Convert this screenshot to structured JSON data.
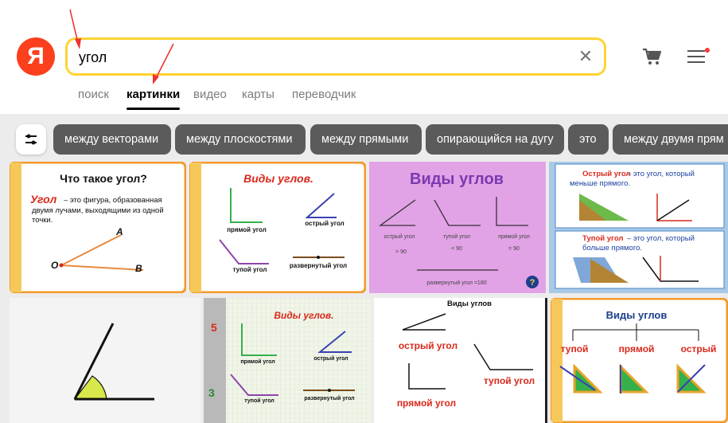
{
  "logo": {
    "letter": "Я"
  },
  "search": {
    "query": "угол",
    "clear_icon": "close-icon"
  },
  "tabs": [
    {
      "label": "поиск"
    },
    {
      "label": "картинки"
    },
    {
      "label": "видео"
    },
    {
      "label": "карты"
    },
    {
      "label": "переводчик"
    }
  ],
  "filters": {
    "settings_icon": "sliders-icon",
    "chips": [
      "между векторами",
      "между плоскостями",
      "между прямыми",
      "опирающийся на дугу",
      "это",
      "между двумя прям"
    ]
  },
  "images": {
    "img1": {
      "title": "Что такое угол?",
      "term": "Угол",
      "def1": " – это фигура, образованная",
      "def2": "двумя лучами, выходящими из одной",
      "def3": "точки.",
      "pA": "A",
      "pO": "O",
      "pB": "B"
    },
    "img2": {
      "title": "Виды углов.",
      "l1": "прямой угол",
      "l2": "острый угол",
      "l3": "тупой угол",
      "l4": "развернутый угол"
    },
    "img3": {
      "title": "Виды углов",
      "l1": "острый угол",
      "l2": "тупой угол",
      "l3": "прямой угол",
      "v1": "> 90",
      "v2": "< 90",
      "v3": "= 90",
      "l4": "развернутый угол =180"
    },
    "img4": {
      "t1a": "Острый угол",
      "t1b": " – это угол, который",
      "t1c": "меньше прямого.",
      "t2a": "Тупой угол",
      "t2b": " – это угол, который",
      "t2c": "больше прямого."
    },
    "img6": {
      "title": "Виды углов.",
      "l1": "прямой угол",
      "l2": "острый угол",
      "l3": "тупой угол",
      "l4": "развернутый угол",
      "n1": "5",
      "n2": "3"
    },
    "img7": {
      "title": "Виды углов",
      "l1": "острый угол",
      "l2": "тупой угол",
      "l3": "прямой угол"
    },
    "img8": {
      "title": "Виды углов",
      "l1": "тупой",
      "l2": "прямой",
      "l3": "острый"
    }
  },
  "colors": {
    "accent": "#ffd333",
    "logo": "#fc3f1d",
    "chip": "#5b5b5b"
  }
}
